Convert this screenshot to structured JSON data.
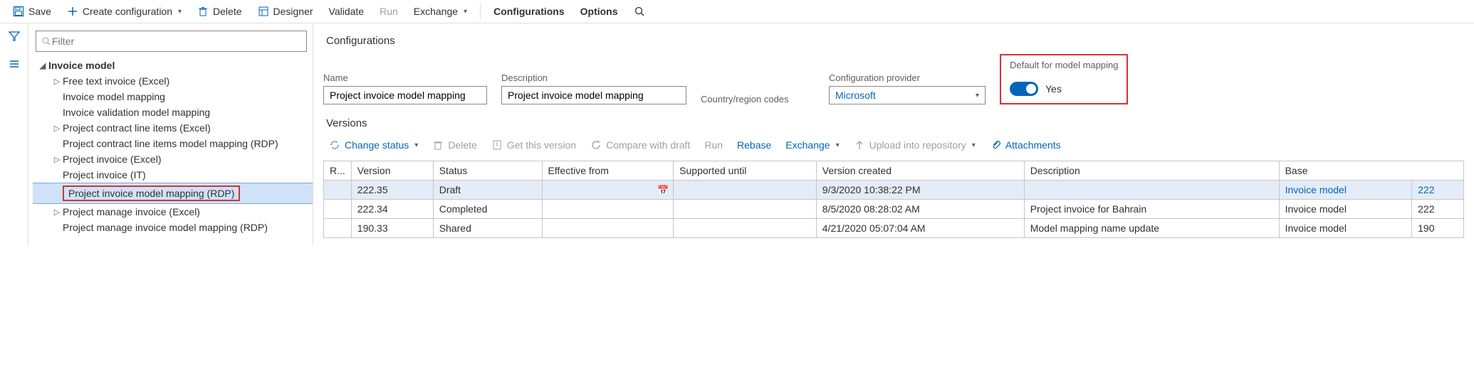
{
  "toolbar": {
    "save": "Save",
    "create": "Create configuration",
    "delete": "Delete",
    "designer": "Designer",
    "validate": "Validate",
    "run": "Run",
    "exchange": "Exchange",
    "configurations": "Configurations",
    "options": "Options"
  },
  "tree": {
    "filter_placeholder": "Filter",
    "root": "Invoice model",
    "items": [
      {
        "exp": "▷",
        "label": "Free text invoice (Excel)"
      },
      {
        "exp": "",
        "label": "Invoice model mapping"
      },
      {
        "exp": "",
        "label": "Invoice validation model mapping"
      },
      {
        "exp": "▷",
        "label": "Project contract line items (Excel)"
      },
      {
        "exp": "",
        "label": "Project contract line items model mapping (RDP)"
      },
      {
        "exp": "▷",
        "label": "Project invoice (Excel)"
      },
      {
        "exp": "",
        "label": "Project invoice (IT)"
      },
      {
        "exp": "",
        "label": "Project invoice model mapping (RDP)",
        "selected": true
      },
      {
        "exp": "▷",
        "label": "Project manage invoice (Excel)"
      },
      {
        "exp": "",
        "label": "Project manage invoice model mapping (RDP)"
      }
    ]
  },
  "detail": {
    "section": "Configurations",
    "name_label": "Name",
    "name_value": "Project invoice model mapping",
    "desc_label": "Description",
    "desc_value": "Project invoice model mapping",
    "country_label": "Country/region codes",
    "provider_label": "Configuration provider",
    "provider_value": "Microsoft",
    "default_label": "Default for model mapping",
    "default_value": "Yes"
  },
  "versions": {
    "title": "Versions",
    "btns": {
      "change_status": "Change status",
      "delete": "Delete",
      "get": "Get this version",
      "compare": "Compare with draft",
      "run": "Run",
      "rebase": "Rebase",
      "exchange": "Exchange",
      "upload": "Upload into repository",
      "attachments": "Attachments"
    },
    "cols": {
      "r": "R...",
      "version": "Version",
      "status": "Status",
      "eff": "Effective from",
      "sup": "Supported until",
      "created": "Version created",
      "desc": "Description",
      "base": "Base"
    },
    "rows": [
      {
        "version": "222.35",
        "status": "Draft",
        "eff": "",
        "sup": "",
        "created": "9/3/2020 10:38:22 PM",
        "desc": "",
        "base": "Invoice model",
        "basev": "222",
        "selected": true
      },
      {
        "version": "222.34",
        "status": "Completed",
        "eff": "",
        "sup": "",
        "created": "8/5/2020 08:28:02 AM",
        "desc": "Project invoice for Bahrain",
        "base": "Invoice model",
        "basev": "222"
      },
      {
        "version": "190.33",
        "status": "Shared",
        "eff": "",
        "sup": "",
        "created": "4/21/2020 05:07:04 AM",
        "desc": "Model mapping name update",
        "base": "Invoice model",
        "basev": "190"
      }
    ]
  }
}
